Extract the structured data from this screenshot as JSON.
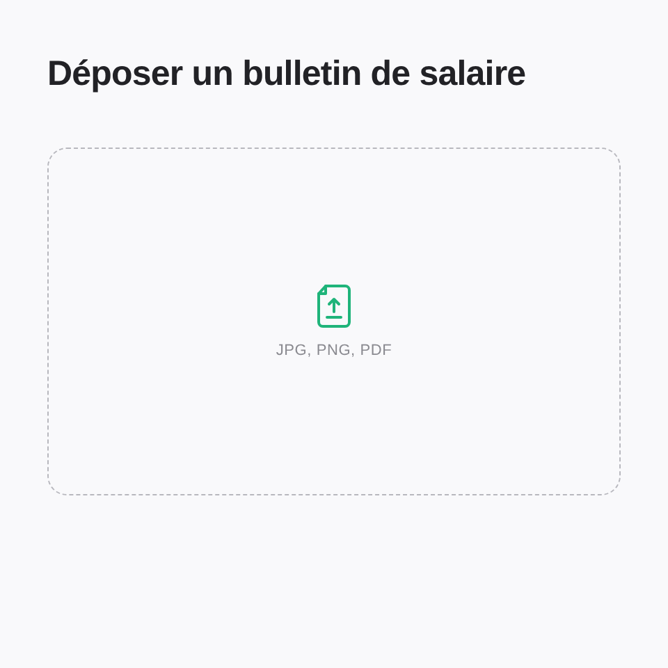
{
  "title": "Déposer un bulletin de salaire",
  "dropzone": {
    "formats": "JPG, PNG, PDF"
  }
}
